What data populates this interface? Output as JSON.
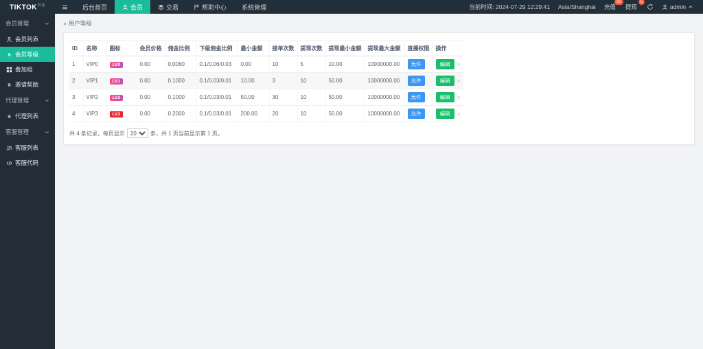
{
  "colors": {
    "accent": "#1abc9c",
    "allow_badge": "#3d96f5",
    "edit_button": "#19be6b",
    "notification_badge": "#ff5b33",
    "lv3_badge": "#e8262d"
  },
  "brand": {
    "name": "TIKTOK",
    "sub": "抖音"
  },
  "topnav": {
    "items": [
      {
        "label": "后台首页",
        "icon": "",
        "active": false
      },
      {
        "label": "会员",
        "icon": "user",
        "active": true
      },
      {
        "label": "交易",
        "icon": "layers",
        "active": false
      },
      {
        "label": "帮助中心",
        "icon": "flag",
        "active": false
      },
      {
        "label": "系统管理",
        "icon": "",
        "active": false
      }
    ],
    "time": "当前时间: 2024-07-29 12:29:41",
    "timezone": "Asia/Shanghai",
    "quick": [
      {
        "label": "充值",
        "badge": "99"
      },
      {
        "label": "提现",
        "badge": "5"
      }
    ],
    "username": "admin"
  },
  "sidebar": {
    "items": [
      {
        "type": "group",
        "label": "会员管理"
      },
      {
        "type": "item",
        "label": "会员列表",
        "icon": "user",
        "active": false
      },
      {
        "type": "item",
        "label": "会员等级",
        "icon": "link",
        "active": true
      },
      {
        "type": "item",
        "label": "叠加组",
        "icon": "grid",
        "active": false
      },
      {
        "type": "item",
        "label": "邀请奖励",
        "icon": "link",
        "active": false
      },
      {
        "type": "group",
        "label": "代理管理"
      },
      {
        "type": "item",
        "label": "代理列表",
        "icon": "link",
        "active": false
      },
      {
        "type": "group",
        "label": "客服管理"
      },
      {
        "type": "item",
        "label": "客服列表",
        "icon": "users",
        "active": false
      },
      {
        "type": "item",
        "label": "客服代码",
        "icon": "code",
        "active": false
      }
    ]
  },
  "breadcrumb": {
    "marker": "»",
    "label": "用户等级"
  },
  "table": {
    "headers": [
      "ID",
      "名称",
      "图标",
      "会员价格",
      "佣金比例",
      "下级佣金比例",
      "最小金额",
      "接单次数",
      "提现次数",
      "提现最小金额",
      "提现最大金额",
      "直播权限",
      "操作"
    ],
    "edit_label": "编辑",
    "rows": [
      {
        "id": "1",
        "name": "VIP0",
        "badge": "LV0",
        "badge_style": "pink",
        "price": "0.00",
        "commission": "0.0060",
        "sub_commission": "0.1/0.06/0.03",
        "min_amount": "0.00",
        "orders": "10",
        "withdraw_times": "5",
        "withdraw_min": "10.00",
        "withdraw_max": "10000000.00",
        "permission": "允许",
        "striped": false
      },
      {
        "id": "2",
        "name": "VIP1",
        "badge": "LV1",
        "badge_style": "pink",
        "price": "0.00",
        "commission": "0.1000",
        "sub_commission": "0.1/0.03/0.01",
        "min_amount": "10.00",
        "orders": "3",
        "withdraw_times": "10",
        "withdraw_min": "50.00",
        "withdraw_max": "10000000.00",
        "permission": "允许",
        "striped": true
      },
      {
        "id": "3",
        "name": "VIP2",
        "badge": "LV2",
        "badge_style": "pink",
        "price": "0.00",
        "commission": "0.1000",
        "sub_commission": "0.1/0.03/0.01",
        "min_amount": "50.00",
        "orders": "30",
        "withdraw_times": "10",
        "withdraw_min": "50.00",
        "withdraw_max": "10000000.00",
        "permission": "允许",
        "striped": false
      },
      {
        "id": "4",
        "name": "VIP3",
        "badge": "LV3",
        "badge_style": "red",
        "price": "0.00",
        "commission": "0.2000",
        "sub_commission": "0.1/0.03/0.01",
        "min_amount": "200.00",
        "orders": "20",
        "withdraw_times": "10",
        "withdraw_min": "50.00",
        "withdraw_max": "10000000.00",
        "permission": "允许",
        "striped": false
      }
    ]
  },
  "pager": {
    "prefix": "共 4 条记录，每页显示",
    "page_size": "20",
    "suffix": "条，共 1 页当前显示第 1 页。"
  }
}
